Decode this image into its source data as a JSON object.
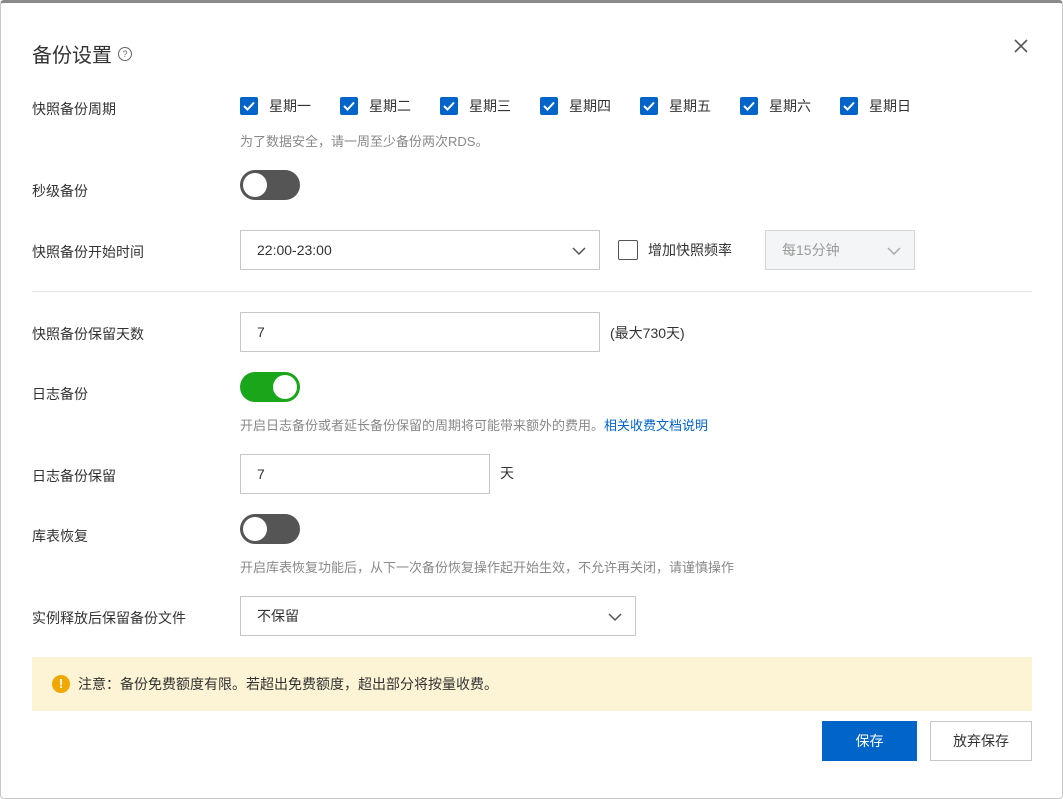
{
  "dialog": {
    "title": "备份设置",
    "help_icon": "question-circle-icon",
    "close_icon": "close-icon"
  },
  "snapshot_cycle": {
    "label": "快照备份周期",
    "days": [
      {
        "label": "星期一",
        "checked": true
      },
      {
        "label": "星期二",
        "checked": true
      },
      {
        "label": "星期三",
        "checked": true
      },
      {
        "label": "星期四",
        "checked": true
      },
      {
        "label": "星期五",
        "checked": true
      },
      {
        "label": "星期六",
        "checked": true
      },
      {
        "label": "星期日",
        "checked": true
      }
    ],
    "hint": "为了数据安全，请一周至少备份两次RDS。"
  },
  "second_backup": {
    "label": "秒级备份",
    "enabled": false
  },
  "start_time": {
    "label": "快照备份开始时间",
    "value": "22:00-23:00",
    "increase_freq_label": "增加快照频率",
    "increase_freq_checked": false,
    "freq_value": "每15分钟"
  },
  "retention_days": {
    "label": "快照备份保留天数",
    "value": "7",
    "suffix": "(最大730天)"
  },
  "log_backup": {
    "label": "日志备份",
    "enabled": true,
    "hint": "开启日志备份或者延长备份保留的周期将可能带来额外的费用。",
    "hint_link": "相关收费文档说明"
  },
  "log_retention": {
    "label": "日志备份保留",
    "value": "7",
    "suffix": "天"
  },
  "table_restore": {
    "label": "库表恢复",
    "enabled": false,
    "hint": "开启库表恢复功能后，从下一次备份恢复操作起开始生效，不允许再关闭，请谨慎操作"
  },
  "keep_after_release": {
    "label": "实例释放后保留备份文件",
    "value": "不保留"
  },
  "notice": {
    "icon": "warning-icon",
    "text": "注意：备份免费额度有限。若超出免费额度，超出部分将按量收费。"
  },
  "buttons": {
    "save": "保存",
    "discard": "放弃保存"
  },
  "colors": {
    "primary": "#0064c8",
    "switch_on": "#1aa61a",
    "switch_off": "#555555",
    "notice_bg": "#fcf4d5",
    "warning": "#f0a800"
  }
}
